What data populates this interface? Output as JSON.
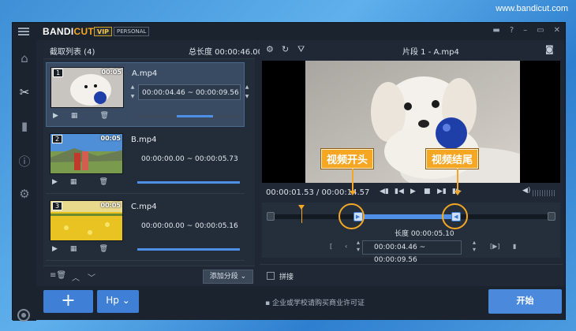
{
  "watermark": "www.bandicut.com",
  "app": {
    "logo_a": "BANDI",
    "logo_b": "CUT",
    "vip": "VIP",
    "edition": "PERSONAL"
  },
  "titlebar_icons": [
    "folder-icon",
    "help-icon",
    "minimize-icon",
    "maximize-icon",
    "close-icon"
  ],
  "sidebar": [
    "home-icon",
    "cut-icon",
    "film-icon",
    "info-icon",
    "settings-icon",
    "record-icon"
  ],
  "clips_panel": {
    "title": "截取列表 (4)",
    "total_label": "总长度 00:00:46.00",
    "clips": [
      {
        "num": "1",
        "duration": "00:05",
        "name": "A.mp4",
        "range": "00:00:04.46 ~ 00:00:09.56",
        "progress_start": 0.38,
        "progress_end": 0.73
      },
      {
        "num": "2",
        "duration": "00:05",
        "name": "B.mp4",
        "range": "00:00:00.00 ~ 00:00:05.73",
        "progress_start": 0.0,
        "progress_end": 1.0
      },
      {
        "num": "3",
        "duration": "00:05",
        "name": "C.mp4",
        "range": "00:00:00.00 ~ 00:00:05.16",
        "progress_start": 0.0,
        "progress_end": 1.0
      }
    ],
    "add_segment": "添加分段 ⌄"
  },
  "editor": {
    "title": "片段 1 - A.mp4",
    "time": "00:00:01.53 / 00:00:14.57",
    "length": "长度 00:00:05.10",
    "range": "00:00:04.46 ~ 00:00:09.56",
    "merge": "拼接",
    "callout_start": "视频开头",
    "callout_end": "视频结尾",
    "playhead": 0.105,
    "selection_start": 0.306,
    "selection_end": 0.656
  },
  "bottom": {
    "add": "+",
    "format": "Hp",
    "notice": "企业或学校请购买商业许可证",
    "start": "开始"
  }
}
